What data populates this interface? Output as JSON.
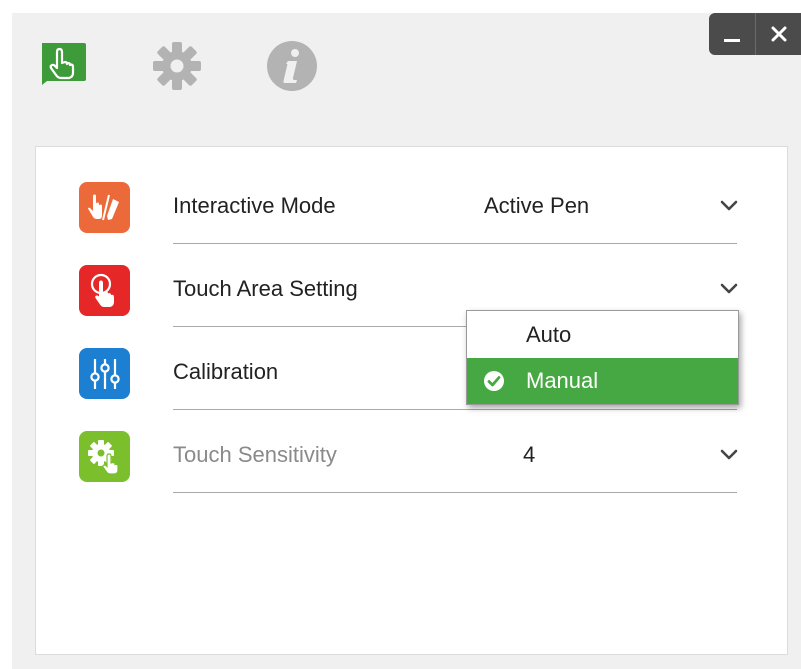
{
  "window_controls": {
    "minimize_label": "_",
    "close_label": "✕"
  },
  "tabs": [
    {
      "name": "touch",
      "icon": "touch-hand-icon",
      "color": "#3e9b3a"
    },
    {
      "name": "settings",
      "icon": "gear-icon",
      "color": "#b3b3b3"
    },
    {
      "name": "info",
      "icon": "info-icon",
      "color": "#b3b3b3"
    }
  ],
  "rows": [
    {
      "label": "Interactive Mode",
      "value": "Active Pen",
      "icon": "pen-touch-icon",
      "color": "#ec6a3a"
    },
    {
      "label": "Touch Area Setting",
      "value": "",
      "icon": "touch-area-icon",
      "color": "#e52727"
    },
    {
      "label": "Calibration",
      "value": "",
      "icon": "sliders-icon",
      "color": "#1d7fd1"
    },
    {
      "label": "Touch Sensitivity",
      "value": "4",
      "icon": "gear-hand-icon",
      "color": "#7cbf2c"
    }
  ],
  "dropdown": {
    "options": [
      {
        "label": "Auto",
        "selected": false
      },
      {
        "label": "Manual",
        "selected": true
      }
    ],
    "selected_color": "#46a842"
  }
}
